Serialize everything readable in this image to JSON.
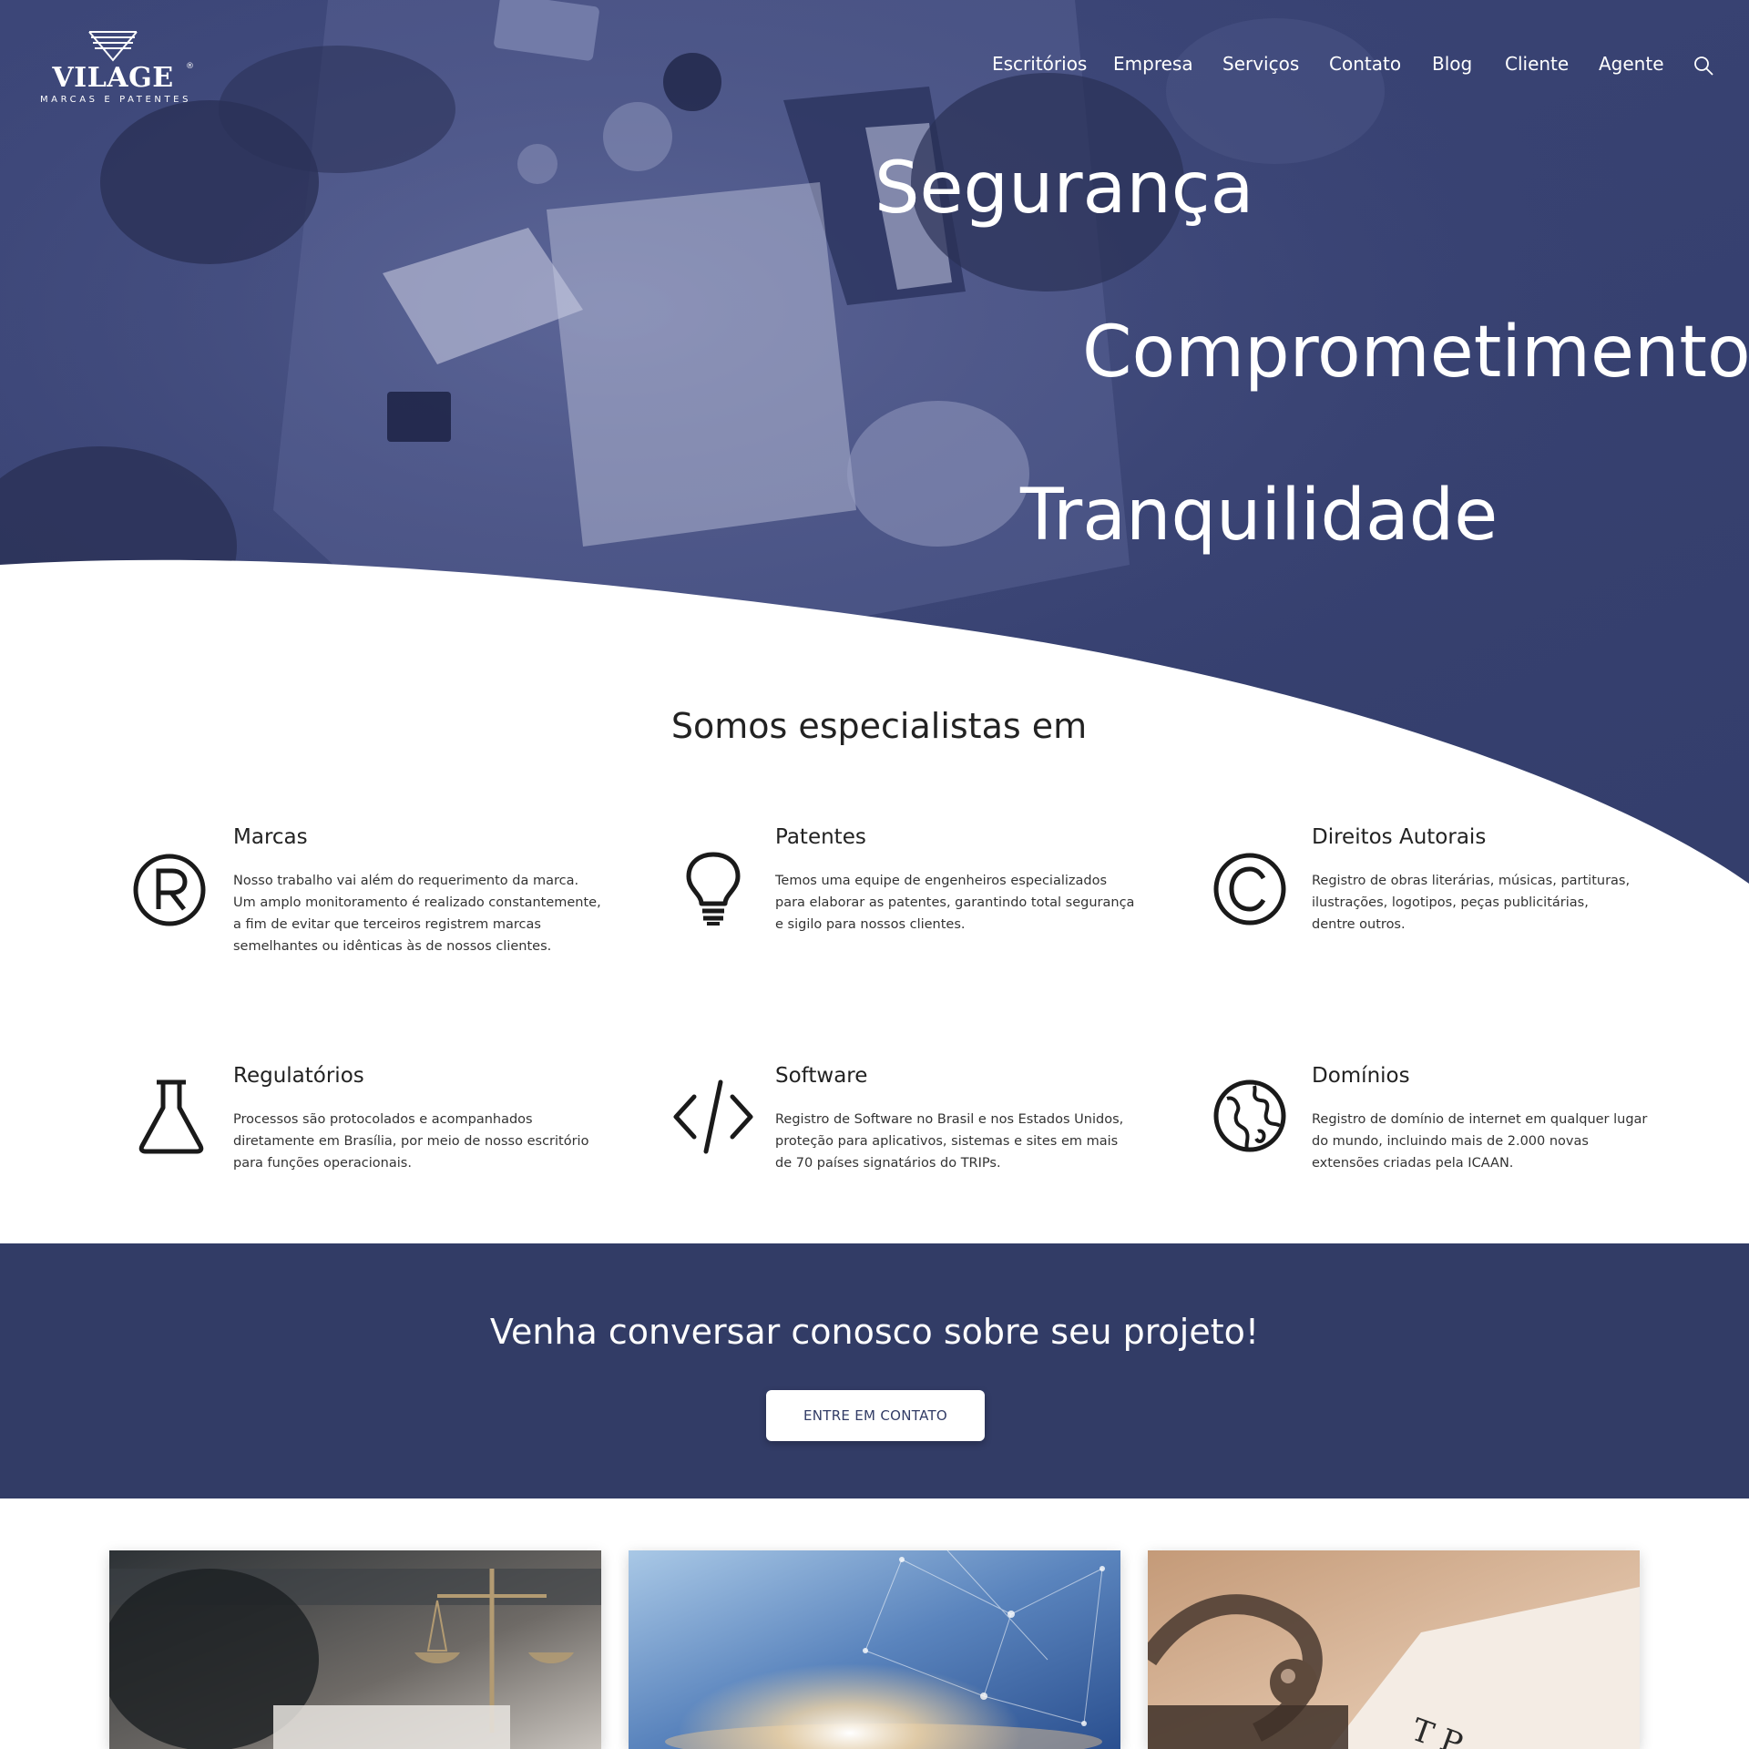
{
  "brand": {
    "name": "VILAGE",
    "tagline": "MARCAS E PATENTES",
    "reg_mark": "®"
  },
  "nav": {
    "items": [
      "Escritórios",
      "Empresa",
      "Serviços",
      "Contato",
      "Blog",
      "Cliente",
      "Agente"
    ],
    "search_icon": "search-icon"
  },
  "hero": {
    "slogans": [
      "Segurança",
      "Comprometimento",
      "Tranquilidade"
    ]
  },
  "specialties": {
    "title": "Somos especialistas em",
    "items": [
      {
        "title": "Marcas",
        "icon": "registered-trademark-icon",
        "lines": [
          "Nosso trabalho vai além do requerimento da marca.",
          "Um amplo monitoramento é realizado constantemente,",
          "a fim de evitar que terceiros registrem marcas",
          "semelhantes ou idênticas às de nossos clientes."
        ]
      },
      {
        "title": "Patentes",
        "icon": "lightbulb-icon",
        "lines": [
          "Temos uma equipe de engenheiros especializados",
          "para elaborar as patentes, garantindo total segurança",
          "e sigilo para nossos clientes."
        ]
      },
      {
        "title": "Direitos Autorais",
        "icon": "copyright-icon",
        "lines": [
          "Registro de obras literárias, músicas, partituras,",
          "ilustrações, logotipos, peças publicitárias,",
          "dentre outros."
        ]
      },
      {
        "title": "Regulatórios",
        "icon": "flask-icon",
        "lines": [
          "Processos são protocolados e acompanhados",
          "diretamente em Brasília, por meio de nosso escritório",
          "para funções operacionais."
        ]
      },
      {
        "title": "Software",
        "icon": "code-icon",
        "lines": [
          "Registro de Software no Brasil e nos Estados Unidos,",
          "proteção para aplicativos, sistemas e sites em mais",
          "de 70 países signatários do TRIPs."
        ]
      },
      {
        "title": "Domínios",
        "icon": "globe-icon",
        "lines": [
          "Registro de domínio de internet em qualquer lugar",
          "do mundo, incluindo mais de 2.000 novas",
          "extensões criadas pela ICAAN."
        ]
      }
    ]
  },
  "cta": {
    "title": "Venha conversar conosco sobre seu projeto!",
    "button": "ENTRE EM CONTATO"
  },
  "colors": {
    "brand_navy": "#323c66",
    "hero_overlay": "#3a4478",
    "white": "#ffffff"
  }
}
